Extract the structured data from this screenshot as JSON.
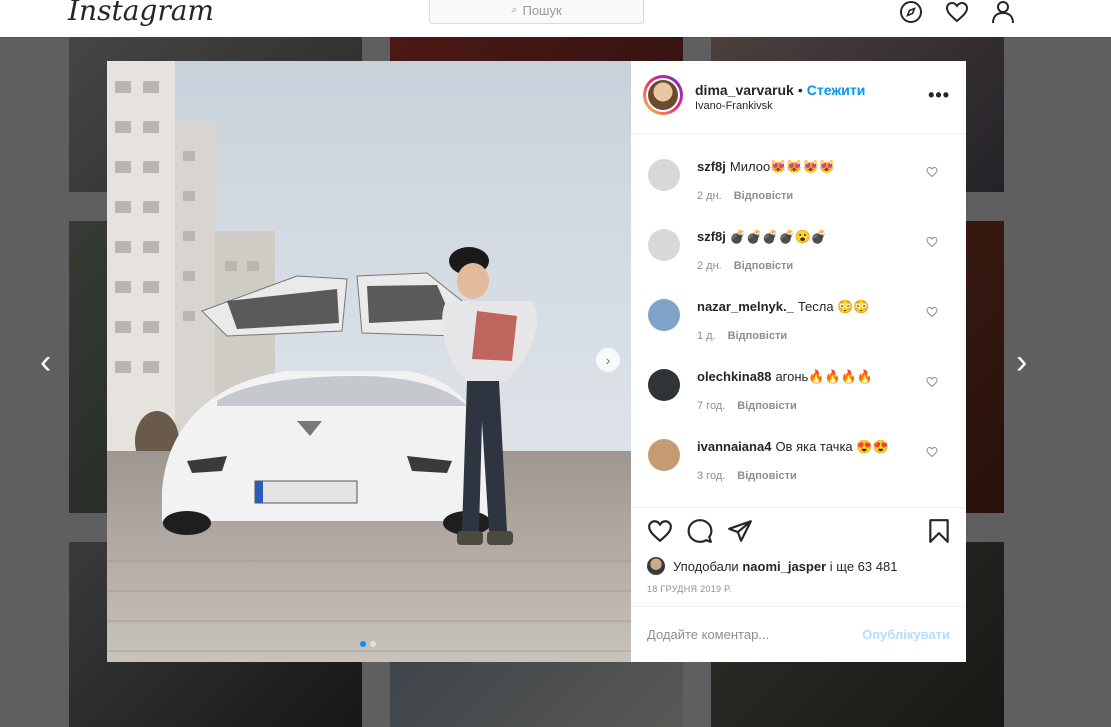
{
  "topbar": {
    "logo": "Instagram",
    "search_placeholder": "Пошук",
    "icons": [
      "explore-icon",
      "heart-icon",
      "profile-icon"
    ]
  },
  "post": {
    "username": "dima_varvaruk",
    "separator": "•",
    "follow_label": "Стежити",
    "location": "Ivano-Frankivsk",
    "more_label": "•••"
  },
  "comments": [
    {
      "user": "szf8j",
      "text": "Милоо😻😻😻😻",
      "time": "2 дн.",
      "reply": "Відповісти",
      "avatar_color": "#d8d8d8"
    },
    {
      "user": "szf8j",
      "text": "💣💣💣💣😮💣",
      "time": "2 дн.",
      "reply": "Відповісти",
      "avatar_color": "#d8d8d8"
    },
    {
      "user": "nazar_melnyk._",
      "text": "Тесла 😳😳",
      "time": "1 д.",
      "reply": "Відповісти",
      "avatar_color": "#7fa3c9"
    },
    {
      "user": "olechkina88",
      "text": "агонь🔥🔥🔥🔥",
      "time": "7 год.",
      "reply": "Відповісти",
      "avatar_color": "#2f3436"
    },
    {
      "user": "ivannaiana4",
      "text": "Ов яка тачка 😍😍",
      "time": "3 год.",
      "reply": "Відповісти",
      "avatar_color": "#c79b72"
    }
  ],
  "likes": {
    "prefix": "Уподобали",
    "user": "naomi_jasper",
    "suffix": "і ще 63 481"
  },
  "date": "18 ГРУДНЯ 2019 Р.",
  "add_comment": {
    "placeholder": "Додайте коментар...",
    "post_label": "Опублікувати"
  },
  "carousel": {
    "total": 2,
    "active": 1
  },
  "colors": {
    "accent": "#0095f6",
    "accent_disabled": "#b2dffc",
    "text": "#262626",
    "muted": "#8e8e8e"
  }
}
